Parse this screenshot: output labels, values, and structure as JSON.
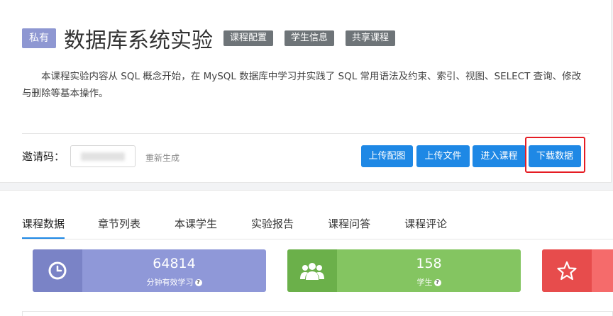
{
  "course": {
    "badge": "私有",
    "title": "数据库系统实验",
    "tags": [
      "课程配置",
      "学生信息",
      "共享课程"
    ],
    "description": "本课程实验内容从 SQL 概念开始，在 MySQL 数据库中学习并实践了 SQL 常用语法及约束、索引、视图、SELECT 查询、修改与删除等基本操作。"
  },
  "invite": {
    "label": "邀请码：",
    "regenerate": "重新生成"
  },
  "actions": {
    "upload_image": "上传配图",
    "upload_file": "上传文件",
    "enter_course": "进入课程",
    "download_data": "下载数据"
  },
  "tabs": [
    "课程数据",
    "章节列表",
    "本课学生",
    "实验报告",
    "课程问答",
    "课程评论"
  ],
  "stats": {
    "study_minutes": {
      "value": "64814",
      "label": "分钟有效学习",
      "icon": "clock-icon"
    },
    "students": {
      "value": "158",
      "label": "学生",
      "icon": "users-icon"
    },
    "rating": {
      "icon": "star-icon"
    }
  },
  "colors": {
    "primary": "#1e88e5",
    "private_badge": "#8e97d2",
    "tag": "#6e7478",
    "highlight": "#e51c23",
    "stat_time": "#8f98d8",
    "stat_student": "#84c561",
    "stat_rating": "#f56b6b"
  }
}
